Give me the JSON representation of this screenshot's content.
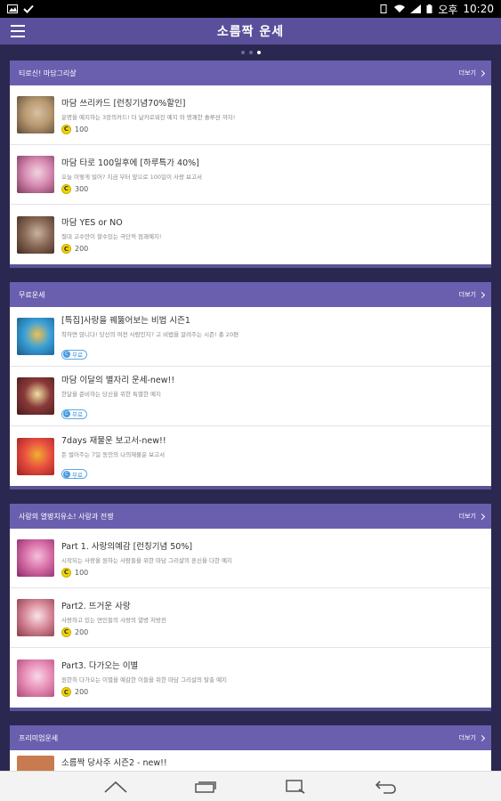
{
  "status": {
    "time_prefix": "오후",
    "time": "10:20"
  },
  "header": {
    "title": "소름짝 운세"
  },
  "sections": [
    {
      "title": "티로신! 마담그리샬",
      "more": "더보기",
      "items": [
        {
          "name": "마담 쓰리카드 [런칭기념70%할인]",
          "desc": "운명을 예지하는 3장의카드! 더 날카로워진 예지 와 명쾌한 솔루션 까지!",
          "price": "100",
          "thumb_colors": [
            "#b89870",
            "#d7c0a3",
            "#5a4a3a"
          ]
        },
        {
          "name": "마담 타로 100일후에 [하루특가 40%]",
          "desc": "오늘 이렇게 빌어? 지금 부터 앞으로 100일이 사랑 보고서",
          "price": "300",
          "thumb_colors": [
            "#d78ab2",
            "#f0d4df",
            "#7a3a5a"
          ]
        },
        {
          "name": "마담 YES or NO",
          "desc": "절대 고수만이 할수있는 극단적 점괘예지!",
          "price": "200",
          "thumb_colors": [
            "#8a6a58",
            "#c8b4a0",
            "#402a20"
          ]
        }
      ]
    },
    {
      "title": "무료운세",
      "more": "더보기",
      "items": [
        {
          "name": "[특집]사랑을 꿰뚫어보는 비법 시즌1",
          "desc": "착하면 않니다! 당신의 여전 사람인지? 고 비법을 알려주는 시즌! 총 20편",
          "free": "무료",
          "thumb_colors": [
            "#3aa0d8",
            "#f0c050",
            "#1a5a8a"
          ]
        },
        {
          "name": "마담 이달의 별자리 운세-new!!",
          "desc": "한달을 준비하는 당신을 위한 특별한 예지",
          "free": "무료",
          "thumb_colors": [
            "#8a3a3a",
            "#f0e0a0",
            "#4a1a1a"
          ]
        },
        {
          "name": "7days 재물운 보고서-new!!",
          "desc": "돈 벌어주는 7일 동안의 나의재물운 보고서",
          "free": "무료",
          "thumb_colors": [
            "#e85040",
            "#f0b030",
            "#a02020"
          ]
        }
      ]
    },
    {
      "title": "사랑의 열병치유소! 사랑과 전쟁",
      "more": "더보기",
      "items": [
        {
          "name": "Part 1. 사랑의예감 [런칭기념 50%]",
          "desc": "시작되는 사랑을 원하는 사람들을 위한 마담 그리샬의 혼신을 다한 예지",
          "price": "100",
          "thumb_colors": [
            "#d870a8",
            "#f4c0dc",
            "#8a2a6a"
          ]
        },
        {
          "name": "Part2. 뜨거운 사랑",
          "desc": "사랑하고 있는 연인들의 사랑의 열병 처방전",
          "price": "200",
          "thumb_colors": [
            "#d88a9a",
            "#f8e4e8",
            "#8a3a4a"
          ]
        },
        {
          "name": "Part3. 다가오는 이별",
          "desc": "원한히 다가오는 이별을 예감한 이들을 위한 마담 그리샬의 탈출 예지",
          "price": "200",
          "thumb_colors": [
            "#e890b8",
            "#f8d8e8",
            "#b04878"
          ]
        }
      ]
    }
  ],
  "partial_section": {
    "title": "프리미엄운세",
    "more": "더보기",
    "item_name": "소름짝 당사주 시즌2 - new!!"
  }
}
